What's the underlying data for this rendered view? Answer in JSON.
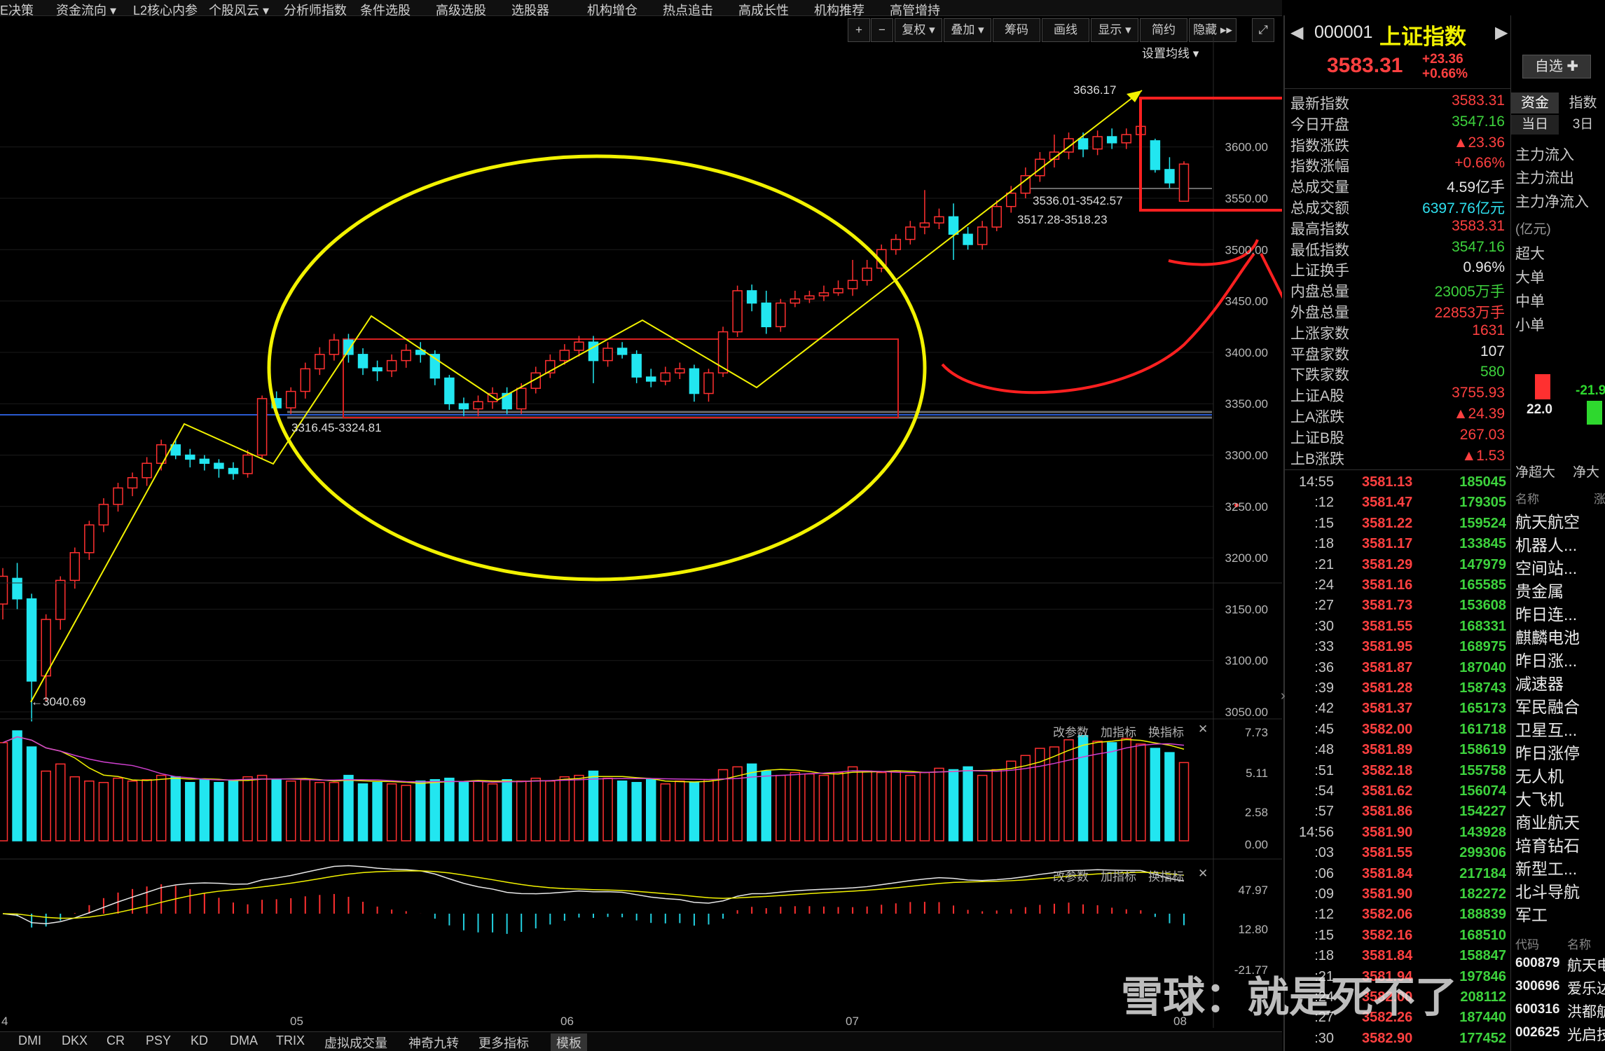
{
  "menu": [
    "E决策",
    "资金流向 ▾",
    "L2核心内参",
    "个股风云 ▾",
    "分析师指数",
    "条件选股",
    "高级选股",
    "选股器",
    "机构增仓",
    "热点追击",
    "高成长性",
    "机构推荐",
    "高管增持"
  ],
  "toolbar": {
    "plus": "+",
    "minus": "−",
    "fuquan": "复权 ▾",
    "diejia": "叠加 ▾",
    "chouma": "筹码",
    "huaxian": "画线",
    "xianshi": "显示 ▾",
    "jianyue": "简约",
    "yincang": "隐藏 ▸▸",
    "expand": "⤢"
  },
  "chart": {
    "set_ma": "设置均线 ▾",
    "y_ticks": [
      "3600.00",
      "3550.00",
      "3500.00",
      "3450.00",
      "3400.00",
      "3350.00",
      "3300.00",
      "3250.00",
      "3200.00",
      "3150.00",
      "3100.00",
      "3050.00"
    ],
    "annotations": {
      "high": "3636.17",
      "low": "←3040.69",
      "gap1": "3536.01-3542.57",
      "gap2": "3517.28-3518.23",
      "support": "3316.45-3324.81"
    },
    "month_labels": [
      "4",
      "05",
      "06",
      "07",
      "08"
    ],
    "vol_ticks": [
      "7.73",
      "5.11",
      "2.58",
      "0.00"
    ],
    "ind_ticks": [
      "47.97",
      "12.80",
      "-21.77"
    ],
    "panel_buttons": [
      "改参数",
      "加指标",
      "换指标",
      "✕"
    ]
  },
  "chart_data": {
    "type": "candlestick",
    "title": "上证指数",
    "ylim": [
      3030,
      3660
    ],
    "annotations": [
      "3636.17",
      "3040.69",
      "3536.01-3542.57",
      "3517.28-3518.23",
      "3316.45-3324.81"
    ],
    "candles": [
      [
        3155,
        3182,
        3140,
        3190
      ],
      [
        3180,
        3160,
        3150,
        3195
      ],
      [
        3160,
        3080,
        3040.69,
        3165
      ],
      [
        3085,
        3140,
        3060,
        3145
      ],
      [
        3140,
        3178,
        3130,
        3182
      ],
      [
        3178,
        3205,
        3170,
        3210
      ],
      [
        3205,
        3232,
        3198,
        3236
      ],
      [
        3232,
        3252,
        3225,
        3258
      ],
      [
        3252,
        3268,
        3245,
        3273
      ],
      [
        3268,
        3278,
        3260,
        3283
      ],
      [
        3278,
        3292,
        3270,
        3298
      ],
      [
        3292,
        3310,
        3285,
        3315
      ],
      [
        3310,
        3300,
        3296,
        3315
      ],
      [
        3300,
        3296,
        3288,
        3306
      ],
      [
        3296,
        3292,
        3285,
        3300
      ],
      [
        3292,
        3287,
        3278,
        3296
      ],
      [
        3287,
        3282,
        3276,
        3293
      ],
      [
        3282,
        3300,
        3278,
        3305
      ],
      [
        3300,
        3355,
        3296,
        3358
      ],
      [
        3355,
        3346,
        3340,
        3362
      ],
      [
        3346,
        3362,
        3340,
        3366
      ],
      [
        3362,
        3384,
        3355,
        3390
      ],
      [
        3384,
        3398,
        3378,
        3405
      ],
      [
        3398,
        3412,
        3392,
        3418
      ],
      [
        3412,
        3398,
        3390,
        3418
      ],
      [
        3398,
        3385,
        3378,
        3404
      ],
      [
        3385,
        3382,
        3372,
        3392
      ],
      [
        3382,
        3392,
        3376,
        3398
      ],
      [
        3392,
        3402,
        3385,
        3408
      ],
      [
        3402,
        3398,
        3390,
        3410
      ],
      [
        3398,
        3375,
        3368,
        3402
      ],
      [
        3375,
        3350,
        3344,
        3378
      ],
      [
        3350,
        3345,
        3338,
        3356
      ],
      [
        3345,
        3352,
        3338,
        3358
      ],
      [
        3352,
        3360,
        3345,
        3366
      ],
      [
        3360,
        3345,
        3340,
        3366
      ],
      [
        3345,
        3365,
        3340,
        3370
      ],
      [
        3365,
        3380,
        3360,
        3386
      ],
      [
        3380,
        3392,
        3375,
        3398
      ],
      [
        3392,
        3402,
        3388,
        3408
      ],
      [
        3402,
        3410,
        3396,
        3416
      ],
      [
        3410,
        3392,
        3370,
        3416
      ],
      [
        3392,
        3404,
        3386,
        3410
      ],
      [
        3404,
        3398,
        3394,
        3410
      ],
      [
        3398,
        3376,
        3370,
        3402
      ],
      [
        3376,
        3372,
        3366,
        3384
      ],
      [
        3372,
        3380,
        3368,
        3386
      ],
      [
        3380,
        3384,
        3374,
        3390
      ],
      [
        3384,
        3360,
        3352,
        3388
      ],
      [
        3360,
        3380,
        3352,
        3384
      ],
      [
        3380,
        3420,
        3376,
        3425
      ],
      [
        3420,
        3460,
        3415,
        3465
      ],
      [
        3460,
        3448,
        3440,
        3466
      ],
      [
        3448,
        3425,
        3418,
        3460
      ],
      [
        3425,
        3448,
        3420,
        3452
      ],
      [
        3448,
        3452,
        3444,
        3460
      ],
      [
        3452,
        3455,
        3448,
        3460
      ],
      [
        3455,
        3458,
        3450,
        3465
      ],
      [
        3458,
        3462,
        3455,
        3470
      ],
      [
        3462,
        3470,
        3455,
        3490
      ],
      [
        3470,
        3482,
        3465,
        3490
      ],
      [
        3482,
        3500,
        3478,
        3505
      ],
      [
        3500,
        3510,
        3495,
        3515
      ],
      [
        3510,
        3522,
        3505,
        3528
      ],
      [
        3522,
        3526,
        3515,
        3558
      ],
      [
        3526,
        3532,
        3520,
        3540
      ],
      [
        3532,
        3515,
        3490,
        3545
      ],
      [
        3515,
        3505,
        3500,
        3522
      ],
      [
        3505,
        3522,
        3500,
        3528
      ],
      [
        3522,
        3542,
        3518,
        3548
      ],
      [
        3542,
        3555,
        3536,
        3562
      ],
      [
        3555,
        3572,
        3550,
        3580
      ],
      [
        3572,
        3588,
        3566,
        3595
      ],
      [
        3588,
        3595,
        3580,
        3612
      ],
      [
        3595,
        3608,
        3588,
        3614
      ],
      [
        3608,
        3598,
        3590,
        3614
      ],
      [
        3598,
        3610,
        3592,
        3616
      ],
      [
        3610,
        3604,
        3598,
        3618
      ],
      [
        3604,
        3612,
        3598,
        3618
      ],
      [
        3612,
        3620,
        3606,
        3636.17
      ],
      [
        3606,
        3578,
        3575,
        3608
      ],
      [
        3578,
        3565,
        3560,
        3590
      ],
      [
        3547.16,
        3583.31,
        3547.16,
        3586
      ]
    ],
    "volume": [
      6.9,
      7.73,
      6.6,
      4.9,
      5.4,
      4.5,
      4.2,
      4.1,
      4.4,
      4.2,
      4.3,
      4.6,
      4.5,
      4.1,
      4.3,
      4.1,
      4.2,
      4.5,
      4.6,
      4.3,
      4.2,
      4.3,
      4.1,
      4.1,
      4.6,
      4.0,
      4.1,
      4.0,
      3.9,
      4.2,
      4.3,
      4.4,
      4.1,
      4.2,
      4.0,
      4.3,
      4.2,
      4.4,
      4.2,
      4.5,
      4.6,
      4.9,
      4.4,
      4.2,
      4.1,
      4.3,
      4.0,
      4.2,
      4.1,
      4.3,
      5.0,
      5.2,
      5.4,
      4.9,
      4.6,
      4.8,
      4.7,
      4.6,
      4.8,
      5.2,
      4.9,
      4.8,
      4.9,
      4.6,
      4.8,
      5.1,
      5.0,
      5.2,
      4.6,
      5.0,
      5.6,
      6.0,
      6.5,
      6.6,
      7.1,
      7.4,
      7.0,
      6.9,
      7.2,
      6.8,
      6.5,
      6.2,
      5.5
    ]
  },
  "quote": {
    "code": "000001",
    "name": "上证指数",
    "price": "3583.31",
    "change": "+23.36",
    "pct": "+0.66%",
    "zixuan": "自选 ✚",
    "rows": [
      {
        "l": "最新指数",
        "v": "3583.31",
        "c": "red"
      },
      {
        "l": "今日开盘",
        "v": "3547.16",
        "c": "green"
      },
      {
        "l": "指数涨跌",
        "v": "▲23.36",
        "c": "red"
      },
      {
        "l": "指数涨幅",
        "v": "+0.66%",
        "c": "red"
      },
      {
        "l": "总成交量",
        "v": "4.59亿手",
        "c": "white"
      },
      {
        "l": "总成交额",
        "v": "6397.76亿元",
        "c": "cyan"
      },
      {
        "l": "最高指数",
        "v": "3583.31",
        "c": "red"
      },
      {
        "l": "最低指数",
        "v": "3547.16",
        "c": "green"
      },
      {
        "l": "上证换手",
        "v": "0.96%",
        "c": "white"
      },
      {
        "l": "内盘总量",
        "v": "23005万手",
        "c": "green"
      },
      {
        "l": "外盘总量",
        "v": "22853万手",
        "c": "red"
      },
      {
        "l": "上涨家数",
        "v": "1631",
        "c": "red"
      },
      {
        "l": "平盘家数",
        "v": "107",
        "c": "white"
      },
      {
        "l": "下跌家数",
        "v": "580",
        "c": "green"
      },
      {
        "l": "上证A股",
        "v": "3755.93",
        "c": "red"
      },
      {
        "l": "上A涨跌",
        "v": "▲24.39",
        "c": "red"
      },
      {
        "l": "上证B股",
        "v": "267.03",
        "c": "red"
      },
      {
        "l": "上B涨跌",
        "v": "▲1.53",
        "c": "red"
      }
    ],
    "ticks": [
      {
        "t": "14:55",
        "p": "3581.13",
        "v": "185045"
      },
      {
        "t": ":12",
        "p": "3581.47",
        "v": "179305"
      },
      {
        "t": ":15",
        "p": "3581.22",
        "v": "159524"
      },
      {
        "t": ":18",
        "p": "3581.17",
        "v": "133845"
      },
      {
        "t": ":21",
        "p": "3581.29",
        "v": "147979"
      },
      {
        "t": ":24",
        "p": "3581.16",
        "v": "165585"
      },
      {
        "t": ":27",
        "p": "3581.73",
        "v": "153608"
      },
      {
        "t": ":30",
        "p": "3581.55",
        "v": "168331"
      },
      {
        "t": ":33",
        "p": "3581.95",
        "v": "168975"
      },
      {
        "t": ":36",
        "p": "3581.87",
        "v": "187040"
      },
      {
        "t": ":39",
        "p": "3581.28",
        "v": "158743"
      },
      {
        "t": ":42",
        "p": "3581.37",
        "v": "165173"
      },
      {
        "t": ":45",
        "p": "3582.00",
        "v": "161718"
      },
      {
        "t": ":48",
        "p": "3581.89",
        "v": "158619"
      },
      {
        "t": ":51",
        "p": "3582.18",
        "v": "155758"
      },
      {
        "t": ":54",
        "p": "3581.62",
        "v": "156074"
      },
      {
        "t": ":57",
        "p": "3581.86",
        "v": "154227"
      },
      {
        "t": "14:56",
        "p": "3581.90",
        "v": "143928"
      },
      {
        "t": ":03",
        "p": "3581.55",
        "v": "299306"
      },
      {
        "t": ":06",
        "p": "3581.84",
        "v": "217184"
      },
      {
        "t": ":09",
        "p": "3581.90",
        "v": "182272"
      },
      {
        "t": ":12",
        "p": "3582.06",
        "v": "188839"
      },
      {
        "t": ":15",
        "p": "3582.16",
        "v": "168510"
      },
      {
        "t": ":18",
        "p": "3581.84",
        "v": "158847"
      },
      {
        "t": ":21",
        "p": "3581.94",
        "v": "197846"
      },
      {
        "t": ":24",
        "p": "3582.00",
        "v": "208112"
      },
      {
        "t": ":27",
        "p": "3582.26",
        "v": "187440"
      },
      {
        "t": ":30",
        "p": "3582.90",
        "v": "177452"
      }
    ]
  },
  "side": {
    "tab1": "资金",
    "tab2": "指数",
    "day1": "当日",
    "day3": "3日",
    "flows": [
      "主力流入",
      "主力流出",
      "主力净流入"
    ],
    "unit": "(亿元)",
    "sizes": [
      "超大",
      "大单",
      "中单",
      "小单"
    ],
    "bar_pos": "22.0",
    "bar_neg": "-21.9",
    "net_labels": [
      "净超大",
      "净大"
    ],
    "col_name": "名称",
    "col_chg": "涨",
    "sectors": [
      "航天航空",
      "机器人...",
      "空间站...",
      "贵金属",
      "昨日连...",
      "麒麟电池",
      "昨日涨...",
      "减速器",
      "军民融合",
      "卫星互...",
      "昨日涨停",
      "无人机",
      "大飞机",
      "商业航天",
      "培育钻石",
      "新型工...",
      "北斗导航",
      "军工"
    ],
    "col_code": "代码",
    "col_name2": "名称",
    "stocks": [
      {
        "code": "600879",
        "name": "航天电"
      },
      {
        "code": "300696",
        "name": "爱乐达"
      },
      {
        "code": "600316",
        "name": "洪都航"
      },
      {
        "code": "002625",
        "name": "光启技"
      }
    ]
  },
  "bottom_tabs": [
    "DMI",
    "DKX",
    "CR",
    "PSY",
    "KD",
    "DMA",
    "TRIX",
    "虚拟成交量",
    "神奇九转",
    "更多指标",
    "模板"
  ],
  "watermark": "雪球：就是死不了",
  "colors": {
    "up": "#ff3030",
    "down": "#22e6f0",
    "ma_yellow": "#f2f200",
    "ann_red": "#ff2020"
  }
}
